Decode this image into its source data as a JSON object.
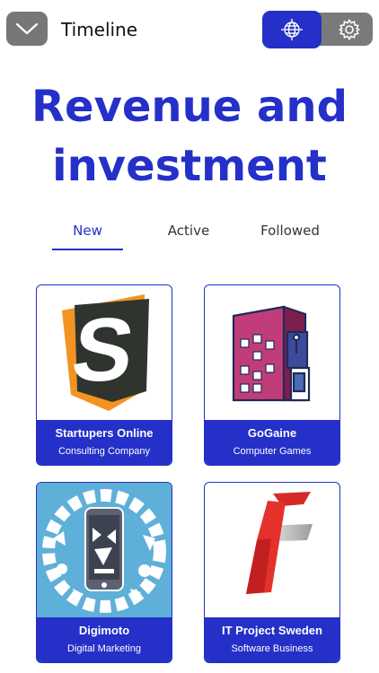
{
  "header": {
    "title": "Timeline",
    "menu_icon": "chevron-down-icon",
    "toggle": {
      "active": "globe-icon",
      "inactive": "gear-icon"
    }
  },
  "hero": {
    "line1": "Revenue and",
    "line2": "investment"
  },
  "tabs": [
    {
      "label": "New",
      "active": true
    },
    {
      "label": "Active",
      "active": false
    },
    {
      "label": "Followed",
      "active": false
    }
  ],
  "cards": [
    {
      "title": "Startupers Online",
      "subtitle": "Consulting Company",
      "logo": "startupers-s-logo"
    },
    {
      "title": "GoGaine",
      "subtitle": "Computer Games",
      "logo": "arcade-building-logo"
    },
    {
      "title": "Digimoto",
      "subtitle": "Digital Marketing",
      "logo": "phone-mosaic-logo"
    },
    {
      "title": "IT Project Sweden",
      "subtitle": "Software Business",
      "logo": "it-letter-logo"
    }
  ],
  "colors": {
    "accent": "#2430c7",
    "toggle_gray": "#7a7a7a"
  }
}
